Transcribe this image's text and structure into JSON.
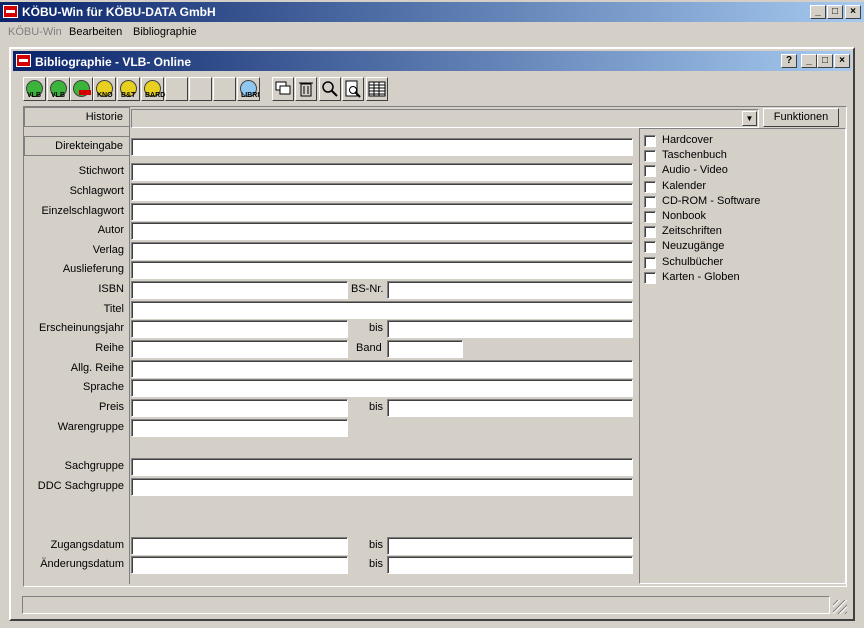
{
  "app": {
    "title": "KÖBU-Win für KÖBU-DATA GmbH",
    "controls": {
      "minimize": "_",
      "maximize": "□",
      "close": "×"
    }
  },
  "menu": [
    {
      "label": "KÖBU-Win",
      "disabled": true
    },
    {
      "label": "Bearbeiten",
      "disabled": false
    },
    {
      "label": "Bibliographie",
      "disabled": false
    }
  ],
  "child": {
    "title": "Bibliographie - VLB- Online",
    "controls": {
      "help": "?",
      "minimize": "_",
      "maximize": "□",
      "close": "×"
    }
  },
  "toolbar": {
    "buttons": [
      {
        "name": "vlb-green-button",
        "label": "VLB",
        "color": "#3cb43c"
      },
      {
        "name": "vlb-green-2-button",
        "label": "VLB",
        "color": "#3cb43c"
      },
      {
        "name": "vlb-red-button",
        "label": "",
        "color": "#3cb43c"
      },
      {
        "name": "kno-button",
        "label": "KNO",
        "color": "#e8d020"
      },
      {
        "name": "bt-button",
        "label": "B&T",
        "color": "#e8d020"
      },
      {
        "name": "bard-button",
        "label": "BARD",
        "color": "#e8d020"
      },
      {
        "name": "empty-button-1",
        "label": "",
        "color": ""
      },
      {
        "name": "empty-button-2",
        "label": "",
        "color": ""
      },
      {
        "name": "empty-button-3",
        "label": "",
        "color": ""
      },
      {
        "name": "libri-button",
        "label": "LIBRI",
        "color": "#8ec8f0"
      }
    ]
  },
  "form": {
    "historie": {
      "label": "Historie",
      "value": ""
    },
    "funktionen_label": "Funktionen",
    "direkteingabe": {
      "label": "Direkteingabe",
      "value": ""
    },
    "fields": {
      "stichwort": "Stichwort",
      "schlagwort": "Schlagwort",
      "einzelschlagwort": "Einzelschlagwort",
      "autor": "Autor",
      "verlag": "Verlag",
      "auslieferung": "Auslieferung",
      "isbn": "ISBN",
      "bsnr": "BS-Nr.",
      "titel": "Titel",
      "erscheinungsjahr": "Erscheinungsjahr",
      "bis": "bis",
      "reihe": "Reihe",
      "band": "Band",
      "allg_reihe": "Allg. Reihe",
      "sprache": "Sprache",
      "preis": "Preis",
      "warengruppe": "Warengruppe",
      "sachgruppe": "Sachgruppe",
      "ddc_sachgruppe": "DDC Sachgruppe",
      "zugangsdatum": "Zugangsdatum",
      "aenderungsdatum": "Änderungsdatum"
    }
  },
  "checkboxes": [
    "Hardcover",
    "Taschenbuch",
    "Audio - Video",
    "Kalender",
    "CD-ROM - Software",
    "Nonbook",
    "Zeitschriften",
    "Neuzugänge",
    "Schulbücher",
    "Karten - Globen"
  ],
  "status": {
    "text": ""
  }
}
